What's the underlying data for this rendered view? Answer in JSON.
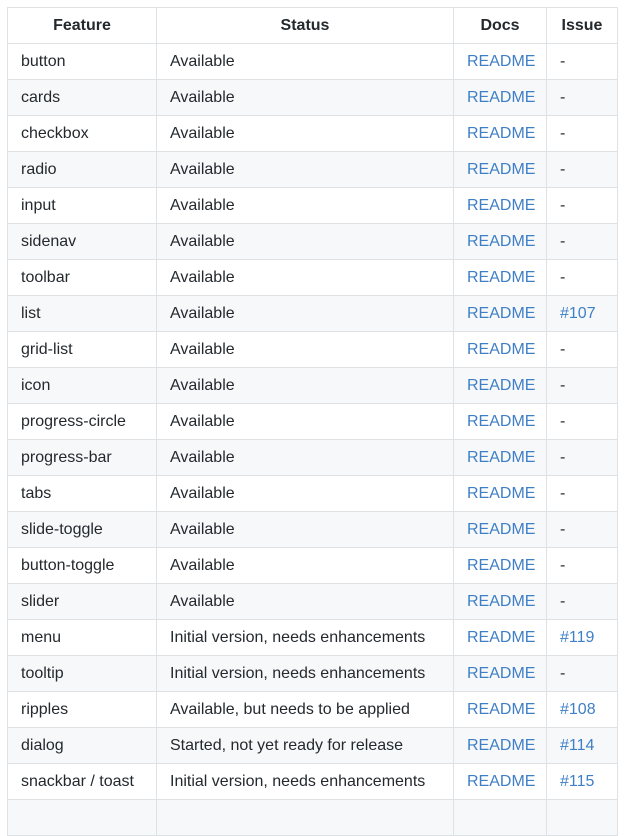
{
  "table": {
    "headers": [
      "Feature",
      "Status",
      "Docs",
      "Issue"
    ],
    "rows": [
      {
        "feature": "button",
        "status": "Available",
        "docs": "README",
        "issue": "-"
      },
      {
        "feature": "cards",
        "status": "Available",
        "docs": "README",
        "issue": "-"
      },
      {
        "feature": "checkbox",
        "status": "Available",
        "docs": "README",
        "issue": "-"
      },
      {
        "feature": "radio",
        "status": "Available",
        "docs": "README",
        "issue": "-"
      },
      {
        "feature": "input",
        "status": "Available",
        "docs": "README",
        "issue": "-"
      },
      {
        "feature": "sidenav",
        "status": "Available",
        "docs": "README",
        "issue": "-"
      },
      {
        "feature": "toolbar",
        "status": "Available",
        "docs": "README",
        "issue": "-"
      },
      {
        "feature": "list",
        "status": "Available",
        "docs": "README",
        "issue": "#107"
      },
      {
        "feature": "grid-list",
        "status": "Available",
        "docs": "README",
        "issue": "-"
      },
      {
        "feature": "icon",
        "status": "Available",
        "docs": "README",
        "issue": "-"
      },
      {
        "feature": "progress-circle",
        "status": "Available",
        "docs": "README",
        "issue": "-"
      },
      {
        "feature": "progress-bar",
        "status": "Available",
        "docs": "README",
        "issue": "-"
      },
      {
        "feature": "tabs",
        "status": "Available",
        "docs": "README",
        "issue": "-"
      },
      {
        "feature": "slide-toggle",
        "status": "Available",
        "docs": "README",
        "issue": "-"
      },
      {
        "feature": "button-toggle",
        "status": "Available",
        "docs": "README",
        "issue": "-"
      },
      {
        "feature": "slider",
        "status": "Available",
        "docs": "README",
        "issue": "-"
      },
      {
        "feature": "menu",
        "status": "Initial version, needs enhancements",
        "docs": "README",
        "issue": "#119"
      },
      {
        "feature": "tooltip",
        "status": "Initial version, needs enhancements",
        "docs": "README",
        "issue": "-"
      },
      {
        "feature": "ripples",
        "status": "Available, but needs to be applied",
        "docs": "README",
        "issue": "#108"
      },
      {
        "feature": "dialog",
        "status": "Started, not yet ready for release",
        "docs": "README",
        "issue": "#114"
      },
      {
        "feature": "snackbar / toast",
        "status": "Initial version, needs enhancements",
        "docs": "README",
        "issue": "#115"
      }
    ]
  },
  "colors": {
    "link": "#3f7fc6",
    "border": "#dfe2e5",
    "stripe": "#f6f8fa",
    "text": "#24292e"
  }
}
